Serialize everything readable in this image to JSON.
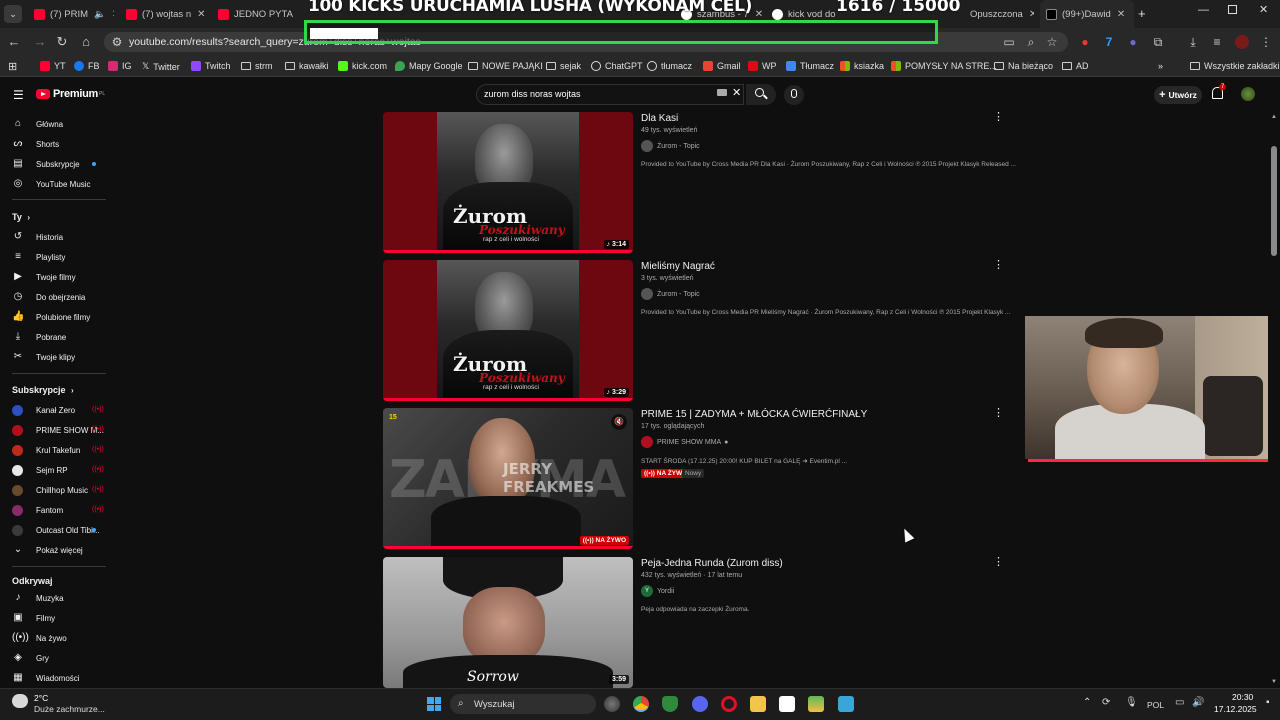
{
  "tabs": [
    {
      "label": "(7) PRIM",
      "icon": "youtube-icon"
    },
    {
      "label": "(7) wojtas n",
      "icon": "youtube-icon"
    },
    {
      "label": "JEDNO PYTA",
      "icon": "youtube-icon"
    },
    {
      "label": "szambus - 7",
      "icon": "google-icon"
    },
    {
      "label": "kick vod do",
      "icon": "google-icon"
    },
    {
      "label": "Opuszczona",
      "icon": "none"
    },
    {
      "label": "(99+)Dawid",
      "icon": "tiktok-icon"
    }
  ],
  "overlay": {
    "goal_text": "100 KICKS URUCHAMIA LUSHA (WYKONAM CEL)",
    "count_text": "1616 / 15000",
    "progress_fraction": 0.108,
    "bar_color": "#32d74b"
  },
  "address_bar": {
    "url": "youtube.com/results?search_query=zurom+diss+noras+wojtas"
  },
  "bookmarks": [
    {
      "label": "YT",
      "icon": "youtube-icon"
    },
    {
      "label": "FB",
      "icon": "facebook-icon"
    },
    {
      "label": "IG",
      "icon": "instagram-icon"
    },
    {
      "label": "Twitter",
      "icon": "x-icon"
    },
    {
      "label": "Twitch",
      "icon": "twitch-icon"
    },
    {
      "label": "strm",
      "icon": "folder-icon"
    },
    {
      "label": "kawałki",
      "icon": "folder-icon"
    },
    {
      "label": "kick.com",
      "icon": "kick-icon"
    },
    {
      "label": "Mapy Google",
      "icon": "maps-icon"
    },
    {
      "label": "NOWE PAJĄKI",
      "icon": "folder-icon"
    },
    {
      "label": "sejak",
      "icon": "folder-icon"
    },
    {
      "label": "ChatGPT",
      "icon": "chatgpt-icon"
    },
    {
      "label": "tłumacz",
      "icon": "chatgpt-icon"
    },
    {
      "label": "Gmail",
      "icon": "gmail-icon"
    },
    {
      "label": "WP",
      "icon": "wp-icon"
    },
    {
      "label": "Tłumacz",
      "icon": "translate-icon"
    },
    {
      "label": "ksiazka",
      "icon": "windows-icon"
    },
    {
      "label": "POMYSŁY NA STRE...",
      "icon": "windows-icon"
    },
    {
      "label": "Na bieżąco",
      "icon": "folder-icon"
    },
    {
      "label": "AD",
      "icon": "folder-icon"
    },
    {
      "label": "Wszystkie zakładki",
      "icon": "folder-icon"
    }
  ],
  "youtube": {
    "logo_text": "Premium",
    "logo_region": "PL",
    "search_value": "zurom diss noras wojtas",
    "create_label": "Utwórz",
    "notifications_count": "7"
  },
  "sidebar": {
    "main": [
      {
        "label": "Główna",
        "icon": "home-icon"
      },
      {
        "label": "Shorts",
        "icon": "shorts-icon"
      },
      {
        "label": "Subskrypcje",
        "icon": "subscriptions-icon"
      },
      {
        "label": "YouTube Music",
        "icon": "music-icon"
      }
    ],
    "you_heading": "Ty",
    "you": [
      {
        "label": "Historia",
        "icon": "history-icon"
      },
      {
        "label": "Playlisty",
        "icon": "playlist-icon"
      },
      {
        "label": "Twoje filmy",
        "icon": "video-icon"
      },
      {
        "label": "Do obejrzenia",
        "icon": "clock-icon"
      },
      {
        "label": "Polubione filmy",
        "icon": "like-icon"
      },
      {
        "label": "Pobrane",
        "icon": "download-icon"
      },
      {
        "label": "Twoje klipy",
        "icon": "scissors-icon"
      }
    ],
    "subs_heading": "Subskrypcje",
    "subs": [
      {
        "label": "Kanał Zero",
        "color": "#2e4fbf"
      },
      {
        "label": "PRIME SHOW M...",
        "color": "#b0101e"
      },
      {
        "label": "Krul Takefun",
        "color": "#c02a1e"
      },
      {
        "label": "Sejm RP",
        "color": "#e8e8e8"
      },
      {
        "label": "Chillhop Music",
        "color": "#6a4a2e"
      },
      {
        "label": "Fantom",
        "color": "#8a2a6a"
      },
      {
        "label": "Outcast Old Tibi...",
        "color": "#3a3a3a"
      }
    ],
    "show_more": "Pokaż więcej",
    "explore_heading": "Odkrywaj",
    "explore": [
      {
        "label": "Muzyka",
        "icon": "music-note-icon"
      },
      {
        "label": "Filmy",
        "icon": "film-icon"
      },
      {
        "label": "Na żywo",
        "icon": "live-icon"
      },
      {
        "label": "Gry",
        "icon": "gamepad-icon"
      },
      {
        "label": "Wiadomości",
        "icon": "news-icon"
      }
    ]
  },
  "results": [
    {
      "title": "Dla Kasi",
      "meta": "49 tys. wyświetleń",
      "channel": "Żurom - Topic",
      "description": "Provided to YouTube by Cross Media PR Dla Kasi · Żurom Poszukiwany, Rap z Celi i Wolności ℗ 2015 Projekt Klasyk Released ...",
      "duration": "3:14",
      "thumb_title": "Żurom",
      "thumb_subtitle": "Poszukiwany",
      "thumb_tag": "rap z celi i wolności",
      "watched_fraction": 1.0
    },
    {
      "title": "Mieliśmy Nagrać",
      "meta": "3 tys. wyświetleń",
      "channel": "Żurom - Topic",
      "description": "Provided to YouTube by Cross Media PR Mieliśmy Nagrać · Żurom Poszukiwany, Rap z Celi i Wolności ℗ 2015 Projekt Klasyk ...",
      "duration": "3:29",
      "thumb_title": "Żurom",
      "thumb_subtitle": "Poszukiwany",
      "thumb_tag": "rap z celi i wolności",
      "watched_fraction": 1.0
    },
    {
      "title": "PRIME 15 | ZADYMA + MŁÓCKA ĆWIERĆFINAŁY",
      "meta": "17 tys. oglądających",
      "channel": "PRIME SHOW MMA",
      "description": "START ŚRODA (17.12.25) 20:00! KUP BILET na GALĘ ➜ Eventim.pl ...",
      "live_badge": "NA ŻYWO",
      "new_badge": "Nowy",
      "thumb_big": "ZADYMA",
      "thumb_name": "JERRY FREAKMES",
      "thumb_num": "15",
      "watched_fraction": 1.0
    },
    {
      "title": "Peja-Jedna Runda (Zurom diss)",
      "meta": "432 tys. wyświetleń · 17 lat temu",
      "channel": "Yordii",
      "channel_initial": "Y",
      "description": "Peja odpowiada na zaczepki Żuroma.",
      "duration": "3:59",
      "thumb_label": "Sorrow"
    }
  ],
  "taskbar": {
    "weather_temp": "2°C",
    "weather_desc": "Duże zachmurze...",
    "search_label": "Wyszukaj",
    "lang": "POL",
    "time": "20:30",
    "date": "17.12.2025"
  }
}
